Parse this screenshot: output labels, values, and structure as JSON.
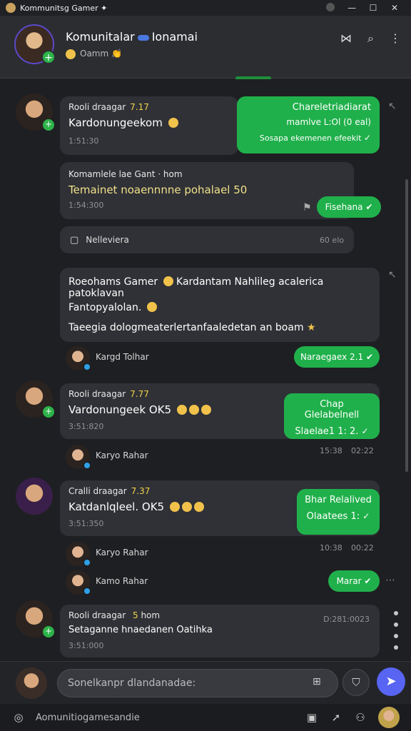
{
  "window": {
    "title": "Kommunitsg Gamer",
    "title_icon": "sparkle-icon"
  },
  "header": {
    "name_left": "Komunitalar",
    "name_right": "Ionamai",
    "subtitle": "Oamm",
    "actions": [
      "share-icon",
      "search-icon",
      "more-vertical-icon"
    ]
  },
  "messages": [
    {
      "sender": "Rooli draagar",
      "num": "7.17",
      "text": "Kardonungeekom",
      "time": "1:51:30",
      "reply": {
        "line1": "Chareletriadiarat",
        "line2": "mamlve L:Ol (0 eal)",
        "line3": "Sosapa ekemenen efeekit"
      }
    },
    {
      "sender": "Komamlele lae Gant",
      "sender_suffix": "hom",
      "text": "Temainet noaennnne pohalael 50",
      "time": "1:54:300",
      "reply_pill": "Fisehana"
    },
    {
      "file": "Nelleviera",
      "file_time": "60 elo"
    },
    {
      "text_line1": "Roeohams Gamer",
      "text_line1b": "Kardantam Nahlileg acalerica patoklavan",
      "text_line2": "Fantopyalolan.",
      "text_line3": "Taeegia dologmeaterlertanfaaledetan an boam"
    },
    {
      "person": "Kargd Tolhar",
      "pill": "Naraegaex 2.1"
    },
    {
      "sender": "Rooli draagar",
      "num": "7.77",
      "text": "Vardonungeek OK5",
      "time": "3:51:820",
      "reply": {
        "line1": "Chap Glelabelnell",
        "line2": "Slaelae1 1: 2."
      }
    },
    {
      "person": "Karyo Rahar",
      "time2": "15:38",
      "time3": "02:22"
    },
    {
      "sender": "Cralli draagar",
      "num": "7.37",
      "text": "Katdanlqleel. OK5",
      "time": "3:51:350",
      "reply": {
        "line1": "Bhar Relalived",
        "line2": "Olaatees 1:"
      }
    },
    {
      "person": "Karyo Rahar",
      "time2": "10:38",
      "time3": "00:22"
    },
    {
      "person": "Kamo Rahar",
      "pill": "Marar"
    },
    {
      "sender": "Rooli draagar",
      "num": "5",
      "sender_suffix": "hom",
      "text": "Setaganne hnaedanen Oatihka",
      "time": "3:51:000",
      "right_time": "D:281:0023"
    }
  ],
  "composer": {
    "placeholder": "Sonelkanpr dlandanadae:"
  },
  "bottombar": {
    "label": "Aomunitiogamesandie"
  },
  "colors": {
    "accent_green": "#20b04b",
    "send_blue": "#5865f2",
    "background": "#1e1f22",
    "bubble": "#2f3136"
  }
}
